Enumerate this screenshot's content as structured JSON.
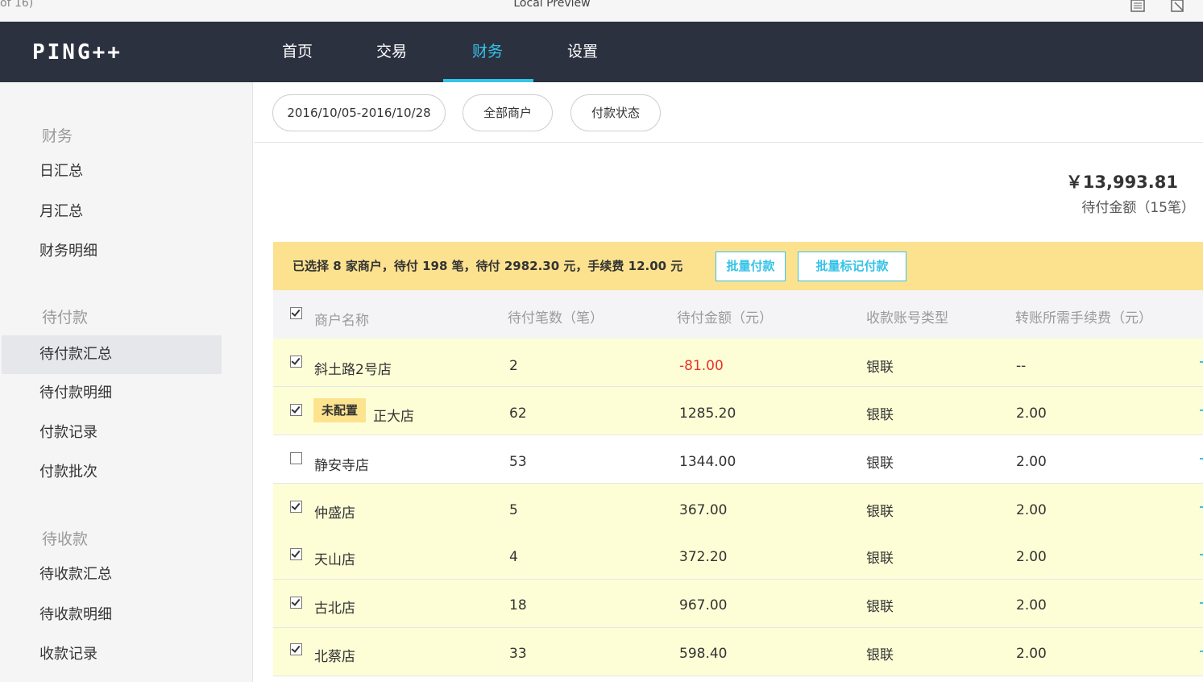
{
  "window": {
    "page_indicator": "of 16)",
    "title": "Local Preview",
    "icons": [
      "document-icon",
      "close-doc-icon"
    ]
  },
  "nav": {
    "logo": "PING++",
    "items": [
      {
        "label": "首页",
        "active": false
      },
      {
        "label": "交易",
        "active": false
      },
      {
        "label": "财务",
        "active": true
      },
      {
        "label": "设置",
        "active": false
      }
    ],
    "accent_color": "#35c3e8"
  },
  "sidebar": {
    "sections": [
      {
        "heading": "财务",
        "items": [
          {
            "label": "日汇总",
            "active": false
          },
          {
            "label": "月汇总",
            "active": false
          },
          {
            "label": "财务明细",
            "active": false
          }
        ]
      },
      {
        "heading": "待付款",
        "items": [
          {
            "label": "待付款汇总",
            "active": true
          },
          {
            "label": "待付款明细",
            "active": false
          },
          {
            "label": "付款记录",
            "active": false
          },
          {
            "label": "付款批次",
            "active": false
          }
        ]
      },
      {
        "heading": "待收款",
        "items": [
          {
            "label": "待收款汇总",
            "active": false
          },
          {
            "label": "待收款明细",
            "active": false
          },
          {
            "label": "收款记录",
            "active": false
          }
        ]
      }
    ]
  },
  "filters": {
    "date_range": "2016/10/05-2016/10/28",
    "merchant": "全部商户",
    "payment_status": "付款状态"
  },
  "summary": {
    "amount": "￥13,993.81",
    "label": "待付金额（15笔）"
  },
  "selection_bar": {
    "text": "已选择 8 家商户，待付 198 笔，待付 2982.30 元，手续费 12.00 元",
    "batch_pay_label": "批量付款",
    "batch_mark_label": "批量标记付款",
    "background": "#fce28f"
  },
  "table": {
    "header_checked": true,
    "columns": [
      "商户名称",
      "待付笔数（笔）",
      "待付金额（元）",
      "收款账号类型",
      "转账所需手续费（元）"
    ],
    "rows": [
      {
        "checked": true,
        "badge": "",
        "name": "斜土路2号店",
        "count": "2",
        "amount": "-81.00",
        "negative": true,
        "account_type": "银联",
        "fee": "--"
      },
      {
        "checked": true,
        "badge": "未配置",
        "name": "正大店",
        "count": "62",
        "amount": "1285.20",
        "negative": false,
        "account_type": "银联",
        "fee": "2.00"
      },
      {
        "checked": false,
        "badge": "",
        "name": "静安寺店",
        "count": "53",
        "amount": "1344.00",
        "negative": false,
        "account_type": "银联",
        "fee": "2.00"
      },
      {
        "checked": true,
        "badge": "",
        "name": "仲盛店",
        "count": "5",
        "amount": "367.00",
        "negative": false,
        "account_type": "银联",
        "fee": "2.00"
      },
      {
        "checked": true,
        "badge": "",
        "name": "天山店",
        "count": "4",
        "amount": "372.20",
        "negative": false,
        "account_type": "银联",
        "fee": "2.00"
      },
      {
        "checked": true,
        "badge": "",
        "name": "古北店",
        "count": "18",
        "amount": "967.00",
        "negative": false,
        "account_type": "银联",
        "fee": "2.00"
      },
      {
        "checked": true,
        "badge": "",
        "name": "北蔡店",
        "count": "33",
        "amount": "598.40",
        "negative": false,
        "account_type": "银联",
        "fee": "2.00"
      }
    ]
  }
}
